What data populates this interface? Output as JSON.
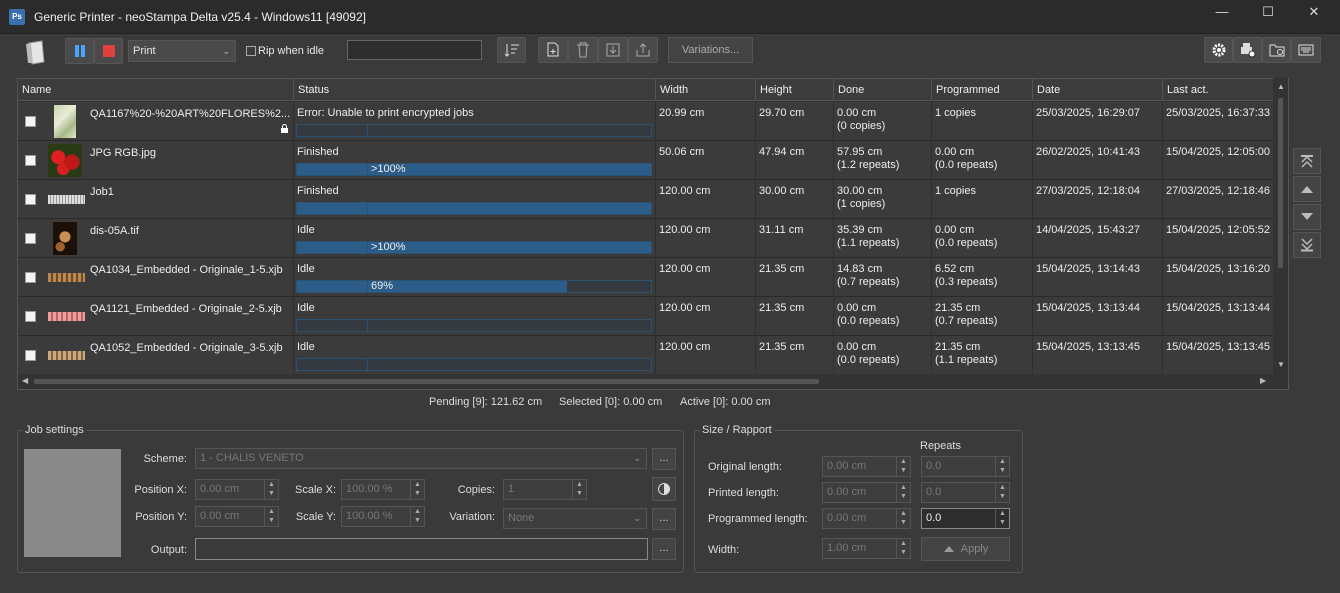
{
  "window": {
    "title": "Generic Printer - neoStampa Delta v25.4 - Windows11 [49092]",
    "icon_text": "Ps",
    "min": "—",
    "max": "☐",
    "close": "✕"
  },
  "toolbar": {
    "mode": "Print",
    "rip_label": "Rip when idle",
    "variations_label": "Variations..."
  },
  "columns": [
    "Name",
    "Status",
    "Width",
    "Height",
    "Done",
    "Programmed",
    "Date",
    "Last act."
  ],
  "jobs": [
    {
      "name": "QA1167%20-%20ART%20FLORES%2...",
      "status": "Error: Unable to print encrypted jobs",
      "progress": "",
      "width": "20.99 cm",
      "height": "29.70 cm",
      "done1": "0.00 cm",
      "done2": "(0 copies)",
      "prog1": "1 copies",
      "prog2": "",
      "date": "25/03/2025, 16:29:07",
      "last": "25/03/2025, 16:37:33"
    },
    {
      "name": "JPG RGB.jpg",
      "status": "Finished",
      "progress": ">100%",
      "width": "50.06 cm",
      "height": "47.94 cm",
      "done1": "57.95 cm",
      "done2": "(1.2 repeats)",
      "prog1": "0.00 cm",
      "prog2": "(0.0 repeats)",
      "date": "26/02/2025, 10:41:43",
      "last": "15/04/2025, 12:05:00"
    },
    {
      "name": "Job1",
      "status": "Finished",
      "progress": "",
      "width": "120.00 cm",
      "height": "30.00 cm",
      "done1": "30.00 cm",
      "done2": "(1 copies)",
      "prog1": "1 copies",
      "prog2": "",
      "date": "27/03/2025, 12:18:04",
      "last": "27/03/2025, 12:18:46"
    },
    {
      "name": "dis-05A.tif",
      "status": "Idle",
      "progress": ">100%",
      "width": "120.00 cm",
      "height": "31.11 cm",
      "done1": "35.39 cm",
      "done2": "(1.1 repeats)",
      "prog1": "0.00 cm",
      "prog2": "(0.0 repeats)",
      "date": "14/04/2025, 15:43:27",
      "last": "15/04/2025, 12:05:52"
    },
    {
      "name": "QA1034_Embedded - Originale_1-5.xjb",
      "status": "Idle",
      "progress": "69%",
      "width": "120.00 cm",
      "height": "21.35 cm",
      "done1": "14.83 cm",
      "done2": "(0.7 repeats)",
      "prog1": "6.52 cm",
      "prog2": "(0.3 repeats)",
      "date": "15/04/2025, 13:14:43",
      "last": "15/04/2025, 13:16:20"
    },
    {
      "name": "QA1121_Embedded - Originale_2-5.xjb",
      "status": "Idle",
      "progress": "",
      "width": "120.00 cm",
      "height": "21.35 cm",
      "done1": "0.00 cm",
      "done2": "(0.0 repeats)",
      "prog1": "21.35 cm",
      "prog2": "(0.7 repeats)",
      "date": "15/04/2025, 13:13:44",
      "last": "15/04/2025, 13:13:44"
    },
    {
      "name": "QA1052_Embedded - Originale_3-5.xjb",
      "status": "Idle",
      "progress": "",
      "width": "120.00 cm",
      "height": "21.35 cm",
      "done1": "0.00 cm",
      "done2": "(0.0 repeats)",
      "prog1": "21.35 cm",
      "prog2": "(1.1 repeats)",
      "date": "15/04/2025, 13:13:45",
      "last": "15/04/2025, 13:13:45"
    }
  ],
  "status": {
    "pending": "Pending [9]: 121.62 cm",
    "selected": "Selected [0]: 0.00 cm",
    "active": "Active [0]: 0.00 cm"
  },
  "job_settings": {
    "legend": "Job settings",
    "scheme_label": "Scheme:",
    "scheme_value": "1 -  CHALIS VENETO",
    "posx_label": "Position X:",
    "posx_value": "0.00 cm",
    "posy_label": "Position Y:",
    "posy_value": "0.00 cm",
    "scalex_label": "Scale X:",
    "scalex_value": "100.00 %",
    "scaley_label": "Scale Y:",
    "scaley_value": "100.00 %",
    "copies_label": "Copies:",
    "copies_value": "1",
    "variation_label": "Variation:",
    "variation_value": "None",
    "output_label": "Output:",
    "dots": "..."
  },
  "size": {
    "legend": "Size / Rapport",
    "repeats": "Repeats",
    "orig_label": "Original length:",
    "orig_value": "0.00 cm",
    "orig_rep": "0.0",
    "printed_label": "Printed length:",
    "printed_value": "0.00 cm",
    "printed_rep": "0.0",
    "prog_label": "Programmed length:",
    "prog_value": "0.00 cm",
    "prog_rep": "0.0",
    "width_label": "Width:",
    "width_value": "1.00 cm",
    "apply": "Apply"
  }
}
